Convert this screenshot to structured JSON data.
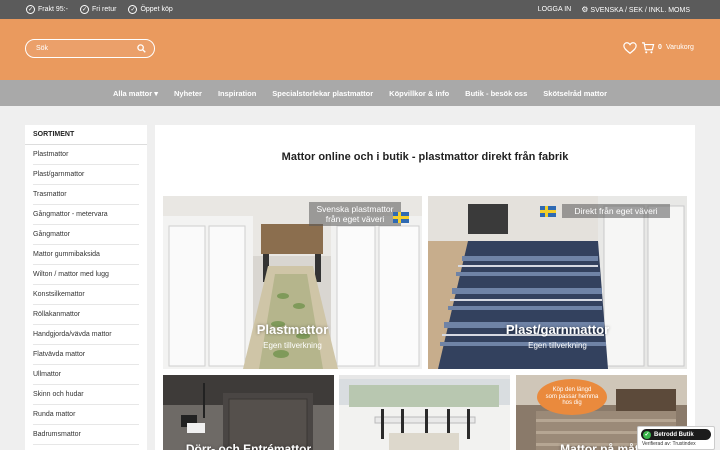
{
  "topbar": {
    "left": [
      "Frakt 95:-",
      "Fri retur",
      "Öppet köp"
    ],
    "login": "LOGGA IN",
    "locale": "SVENSKA / SEK / INKL. MOMS"
  },
  "header": {
    "search_placeholder": "Sök",
    "cart_count": "0",
    "cart_label": "Varukorg"
  },
  "nav": {
    "items": [
      "Alla mattor",
      "Nyheter",
      "Inspiration",
      "Specialstorlekar plastmattor",
      "Köpvillkor & info",
      "Butik - besök oss",
      "Skötselråd mattor"
    ]
  },
  "sidebar": {
    "title": "SORTIMENT",
    "items": [
      "Plastmattor",
      "Plast/garnmattor",
      "Trasmattor",
      "Gångmattor - metervara",
      "Gångmattor",
      "Mattor gummibaksida",
      "Wilton / mattor med lugg",
      "Konstsilkemattor",
      "Röllakanmattor",
      "Handgjorda/vävda mattor",
      "Flatvävda mattor",
      "Ullmattor",
      "Skinn och hudar",
      "Runda mattor",
      "Badrumsmattor"
    ]
  },
  "main": {
    "title": "Mattor online och i butik - plastmattor direkt från fabrik",
    "tiles": [
      {
        "badge_line1": "Svenska plastmattor",
        "badge_line2": "från eget väveri",
        "label": "Plastmattor",
        "sub": "Egen tillverkning"
      },
      {
        "badge_line1": "Direkt från eget väveri",
        "label": "Plast/garnmattor",
        "sub": "Egen tillverkning"
      },
      {
        "label": "Dörr- och Entrémattor"
      },
      {
        "label": ""
      },
      {
        "label": "Mattor på mått",
        "promo_line1": "Köp den längd",
        "promo_line2": "som passar hemma",
        "promo_line3": "hos dig"
      }
    ]
  },
  "trust": {
    "badge": "Betrodd Butik",
    "verified": "Verifierad av: Trustindex"
  },
  "colors": {
    "topbar": "#5b5b5b",
    "header": "#ea9a5e",
    "nav": "#a9a9a9",
    "background": "#efefef"
  }
}
